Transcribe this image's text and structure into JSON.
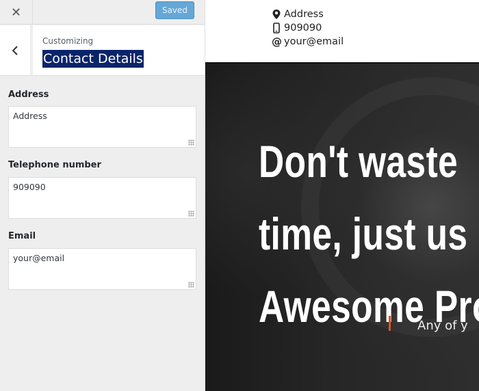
{
  "topbar": {
    "close_icon": "close-icon",
    "save_label": "Saved"
  },
  "section": {
    "back_icon": "chevron-left-icon",
    "context": "Customizing",
    "title": "Contact Details"
  },
  "fields": [
    {
      "label": "Address",
      "value": "Address"
    },
    {
      "label": "Telephone number",
      "value": "909090"
    },
    {
      "label": "Email",
      "value": "your@email"
    }
  ],
  "preview": {
    "contacts": [
      {
        "icon": "map-marker-icon",
        "text": "Address"
      },
      {
        "icon": "mobile-phone-icon",
        "text": "909090"
      },
      {
        "icon": "at-sign-icon",
        "text": "your@email"
      }
    ],
    "hero": {
      "lines": [
        "Don't waste",
        "time, just us",
        "Awesome Pro"
      ],
      "subtext": "Any of y"
    }
  },
  "colors": {
    "accent": "#e0542a",
    "saved_button": "#65a7d6",
    "selection": "#0a246a"
  }
}
